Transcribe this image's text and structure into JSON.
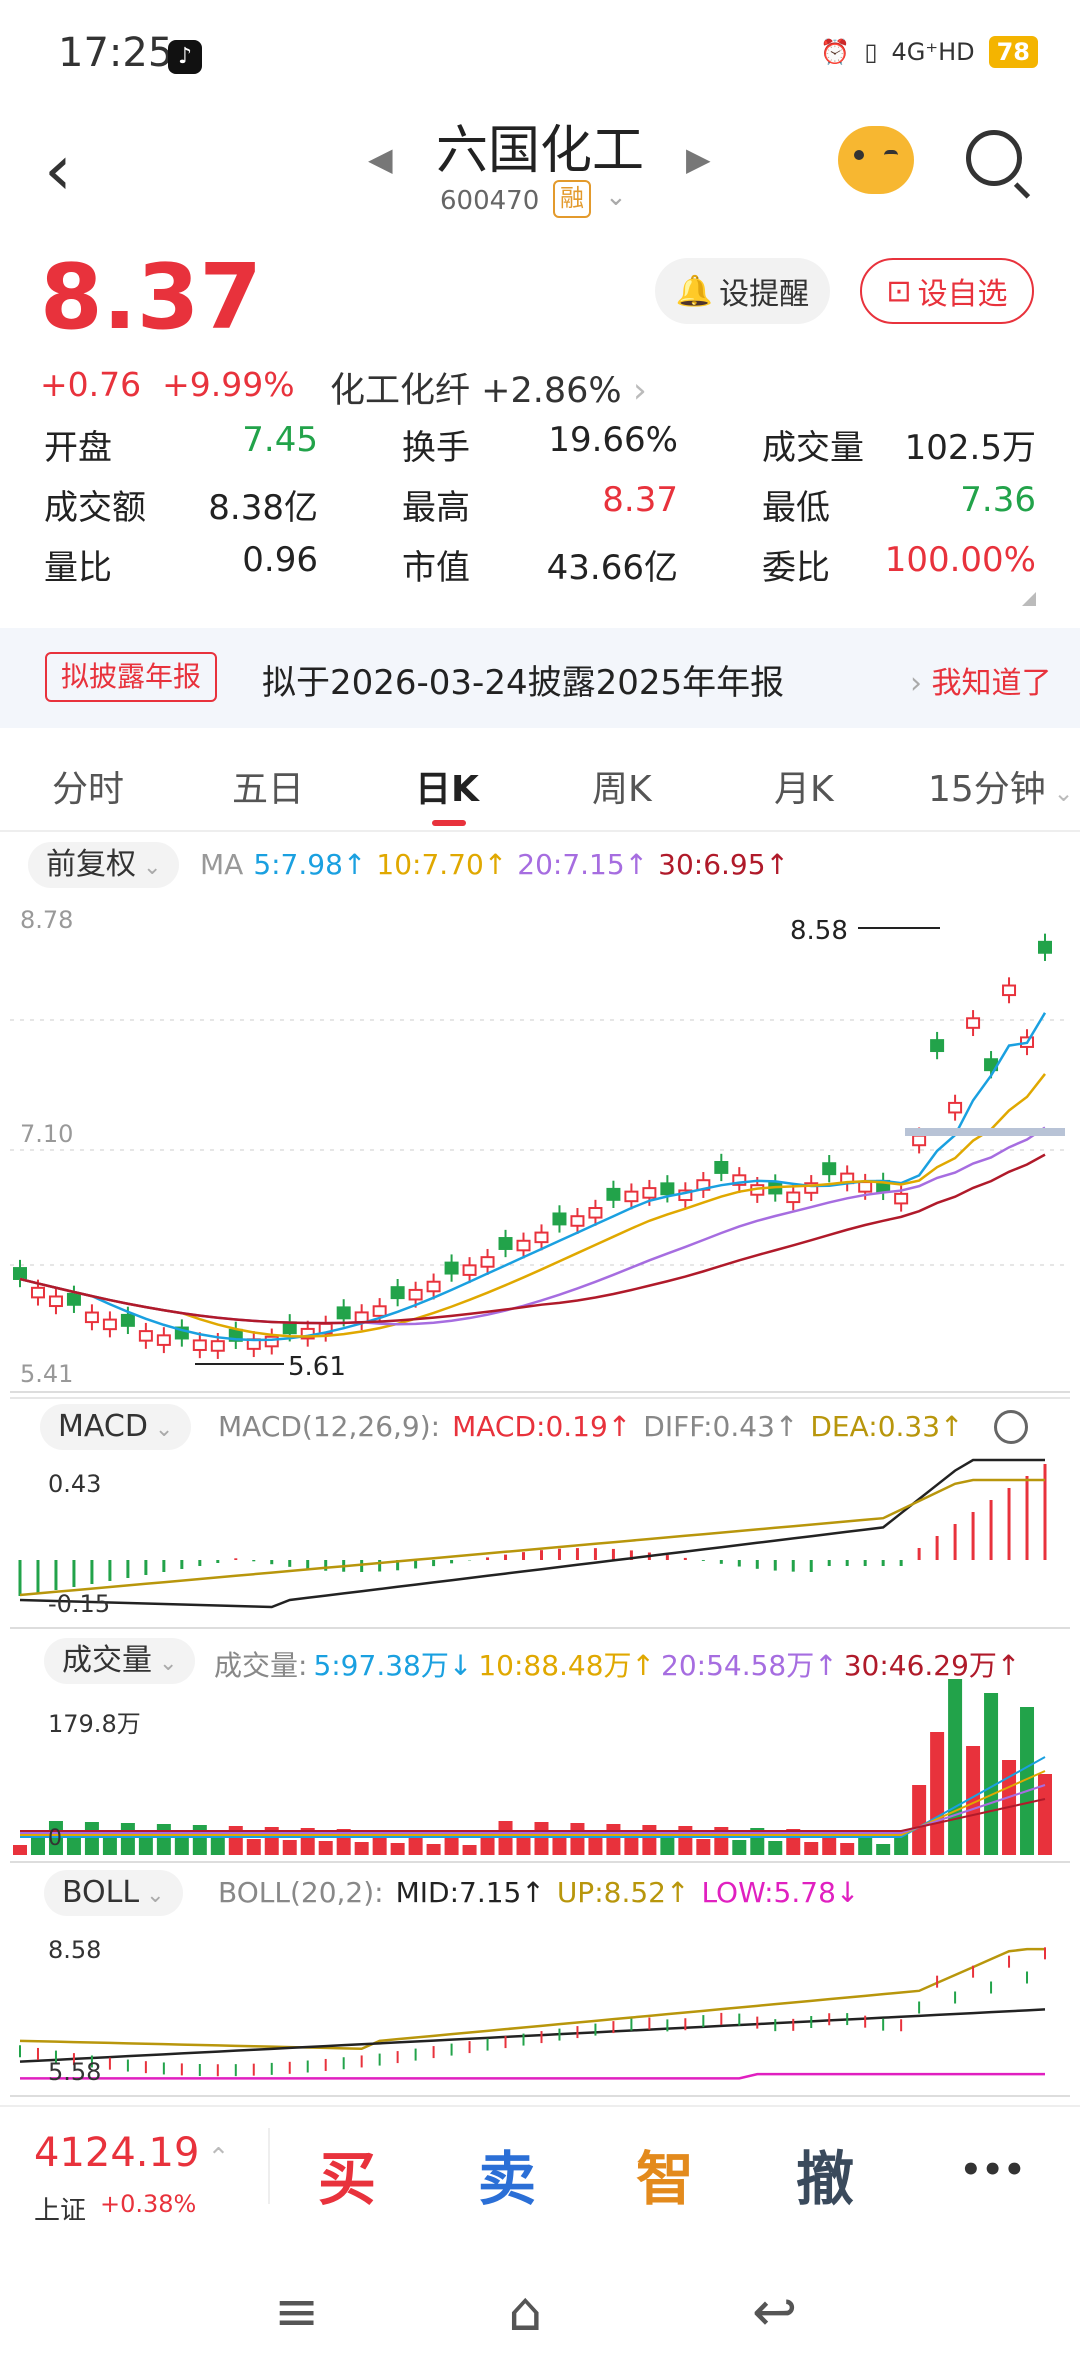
{
  "status": {
    "time": "17:25",
    "network": "4G⁺HD",
    "battery": "78"
  },
  "header": {
    "title": "六国化工",
    "code": "600470",
    "tag": "融"
  },
  "quote": {
    "price": "8.37",
    "change": "+0.76",
    "change_pct": "+9.99%",
    "sector": "化工化纤",
    "sector_pct": "+2.86%"
  },
  "buttons": {
    "remind": "设提醒",
    "favorite": "设自选"
  },
  "stats": [
    {
      "k": "开盘",
      "v": "7.45",
      "c": "dn"
    },
    {
      "k": "换手",
      "v": "19.66%",
      "c": ""
    },
    {
      "k": "成交量",
      "v": "102.5万",
      "c": ""
    },
    {
      "k": "成交额",
      "v": "8.38亿",
      "c": ""
    },
    {
      "k": "最高",
      "v": "8.37",
      "c": "up"
    },
    {
      "k": "最低",
      "v": "7.36",
      "c": "dn"
    },
    {
      "k": "量比",
      "v": "0.96",
      "c": ""
    },
    {
      "k": "市值",
      "v": "43.66亿",
      "c": ""
    },
    {
      "k": "委比",
      "v": "100.00%",
      "c": "up"
    }
  ],
  "notice": {
    "tag": "拟披露年报",
    "text": "拟于2026-03-24披露2025年年报",
    "action": "我知道了"
  },
  "tabs": [
    "分时",
    "五日",
    "日K",
    "周K",
    "月K",
    "15分钟"
  ],
  "kline": {
    "adjust": "前复权",
    "ma_label": "MA",
    "ma": [
      {
        "label": "5:7.98↑",
        "color": "#1aa0e0"
      },
      {
        "label": "10:7.70↑",
        "color": "#e0a800"
      },
      {
        "label": "20:7.15↑",
        "color": "#a66de0"
      },
      {
        "label": "30:6.95↑",
        "color": "#b01a2a"
      }
    ],
    "ymax": "8.78",
    "ymid": "7.10",
    "ymin": "5.41",
    "high_mark": "8.58",
    "low_mark": "5.61"
  },
  "macd": {
    "name": "MACD",
    "params": "MACD(12,26,9):",
    "macd": "MACD:0.19↑",
    "diff": "DIFF:0.43↑",
    "dea": "DEA:0.33↑",
    "ytop": "0.43",
    "ybot": "-0.15"
  },
  "volume": {
    "name": "成交量",
    "label": "成交量:",
    "items": [
      {
        "label": "5:97.38万↓",
        "color": "#1aa0e0"
      },
      {
        "label": "10:88.48万↑",
        "color": "#e0a800"
      },
      {
        "label": "20:54.58万↑",
        "color": "#a66de0"
      },
      {
        "label": "30:46.29万↑",
        "color": "#b01a2a"
      }
    ],
    "ytop": "179.8万",
    "ybot": "0"
  },
  "boll": {
    "name": "BOLL",
    "params": "BOLL(20,2):",
    "mid": "MID:7.15↑",
    "up": "UP:8.52↑",
    "low": "LOW:5.78↓",
    "ytop": "8.58",
    "ybot": "5.58"
  },
  "bottom": {
    "index_value": "4124.19",
    "index_name": "上证",
    "index_change": "+0.38%",
    "buy": "买",
    "sell": "卖",
    "smart": "智",
    "cancel": "撤",
    "more": "•••"
  },
  "colors": {
    "up": "#e8323c",
    "down": "#22a34a"
  }
}
